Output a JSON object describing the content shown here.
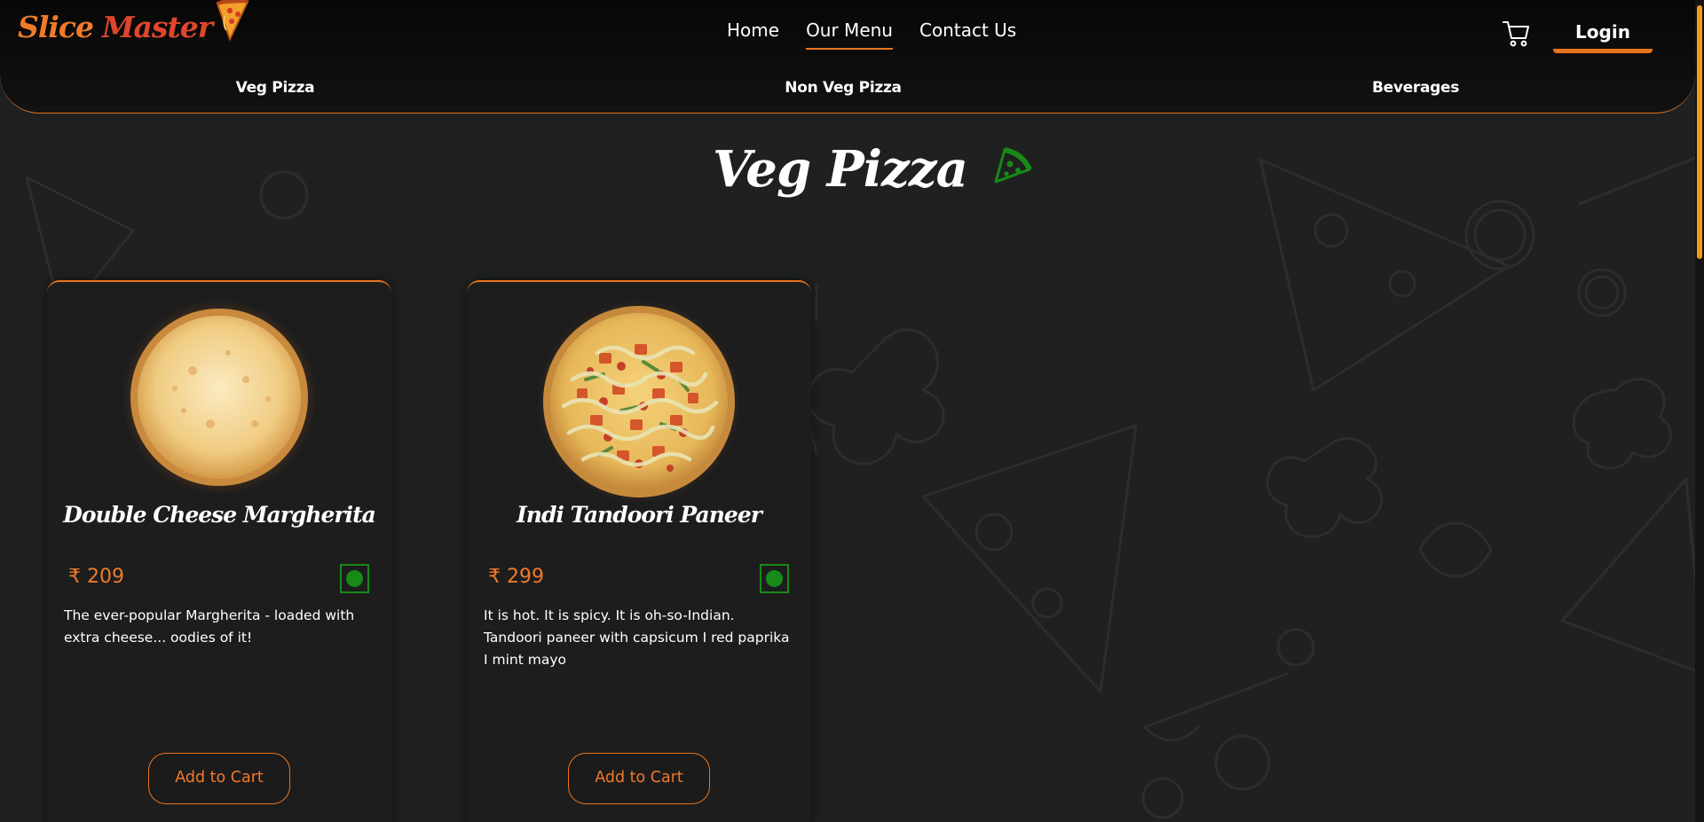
{
  "brand": {
    "name_part1": "Slice",
    "name_part2": "Master"
  },
  "nav": {
    "items": [
      {
        "label": "Home"
      },
      {
        "label": "Our Menu"
      },
      {
        "label": "Contact Us"
      }
    ]
  },
  "header": {
    "login_label": "Login"
  },
  "categories": {
    "items": [
      {
        "label": "Veg Pizza"
      },
      {
        "label": "Non Veg Pizza"
      },
      {
        "label": "Beverages"
      }
    ]
  },
  "section": {
    "title": "Veg Pizza"
  },
  "products": [
    {
      "name": "Double Cheese Margherita",
      "price": "₹ 209",
      "description": "The ever-popular Margherita - loaded with extra cheese... oodies of it!",
      "button_label": "Add to Cart"
    },
    {
      "name": "Indi Tandoori Paneer",
      "price": "₹ 299",
      "description": "It is hot. It is spicy. It is oh-so-Indian. Tandoori paneer with capsicum I red paprika I mint mayo",
      "button_label": "Add to Cart"
    }
  ],
  "colors": {
    "accent": "#e8741e",
    "veg": "#178a17",
    "background": "#1f2020"
  }
}
